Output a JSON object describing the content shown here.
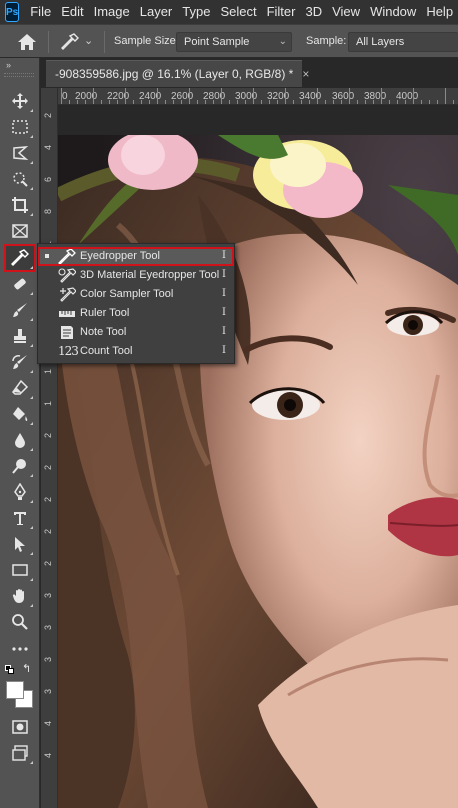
{
  "app": {
    "logo_text": "Ps"
  },
  "menu": [
    "File",
    "Edit",
    "Image",
    "Layer",
    "Type",
    "Select",
    "Filter",
    "3D",
    "View",
    "Window",
    "Help"
  ],
  "options_bar": {
    "sample_size_label": "Sample Size:",
    "sample_size_value": "Point Sample",
    "sample_label": "Sample:",
    "sample_value": "All Layers"
  },
  "document_tab": {
    "title": "-908359586.jpg @ 16.1% (Layer 0, RGB/8) *",
    "close_symbol": "×"
  },
  "ruler": {
    "top_labels": [
      "0",
      "2000",
      "2200",
      "2400",
      "2600",
      "2800",
      "3000",
      "3200",
      "3400",
      "3600",
      "3800",
      "4000"
    ],
    "left_labels": [
      "2",
      "4",
      "6",
      "8",
      "1",
      "1",
      "1",
      "1",
      "1",
      "1",
      "2",
      "2",
      "2",
      "2",
      "2",
      "3",
      "3",
      "3",
      "3",
      "4",
      "4"
    ]
  },
  "tools": [
    {
      "name": "move-icon"
    },
    {
      "name": "marquee-icon"
    },
    {
      "name": "lasso-icon"
    },
    {
      "name": "quick-selection-icon"
    },
    {
      "name": "crop-icon"
    },
    {
      "name": "frame-icon"
    },
    {
      "name": "eyedropper-icon"
    },
    {
      "name": "healing-brush-icon"
    },
    {
      "name": "brush-icon"
    },
    {
      "name": "clone-stamp-icon"
    },
    {
      "name": "history-brush-icon"
    },
    {
      "name": "eraser-icon"
    },
    {
      "name": "paint-bucket-icon"
    },
    {
      "name": "blur-icon"
    },
    {
      "name": "dodge-icon"
    },
    {
      "name": "pen-icon"
    },
    {
      "name": "type-icon"
    },
    {
      "name": "path-selection-icon"
    },
    {
      "name": "rectangle-icon"
    },
    {
      "name": "hand-icon"
    },
    {
      "name": "zoom-icon"
    },
    {
      "name": "more-tools-icon"
    }
  ],
  "flyout": {
    "items": [
      {
        "label": "Eyedropper Tool",
        "shortcut": "I",
        "selected": true
      },
      {
        "label": "3D Material Eyedropper Tool",
        "shortcut": "I",
        "selected": false
      },
      {
        "label": "Color Sampler Tool",
        "shortcut": "I",
        "selected": false
      },
      {
        "label": "Ruler Tool",
        "shortcut": "I",
        "selected": false
      },
      {
        "label": "Note Tool",
        "shortcut": "I",
        "selected": false
      },
      {
        "label": "Count Tool",
        "shortcut": "I",
        "selected": false
      }
    ],
    "count_icon_text": "123"
  },
  "colors": {
    "accent_highlight": "#d0121b",
    "panel_bg": "#535353",
    "menubar_bg": "#323232",
    "foreground_swatch": "#ffffff",
    "background_swatch": "#ffffff"
  }
}
